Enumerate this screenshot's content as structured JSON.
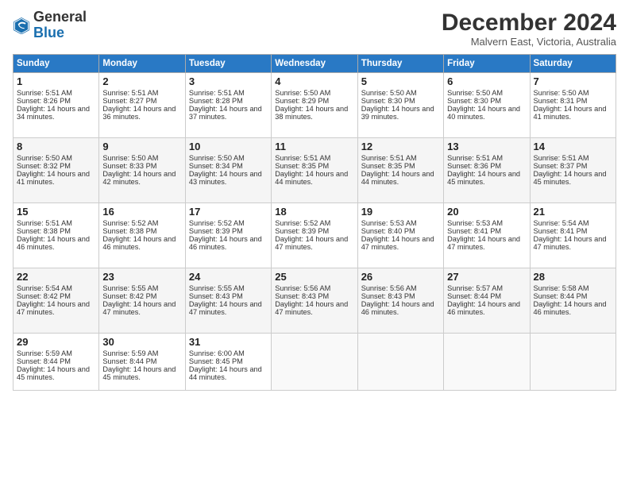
{
  "logo": {
    "general": "General",
    "blue": "Blue"
  },
  "title": "December 2024",
  "location": "Malvern East, Victoria, Australia",
  "days_header": [
    "Sunday",
    "Monday",
    "Tuesday",
    "Wednesday",
    "Thursday",
    "Friday",
    "Saturday"
  ],
  "weeks": [
    [
      {
        "day": "1",
        "sunrise": "Sunrise: 5:51 AM",
        "sunset": "Sunset: 8:26 PM",
        "daylight": "Daylight: 14 hours and 34 minutes."
      },
      {
        "day": "2",
        "sunrise": "Sunrise: 5:51 AM",
        "sunset": "Sunset: 8:27 PM",
        "daylight": "Daylight: 14 hours and 36 minutes."
      },
      {
        "day": "3",
        "sunrise": "Sunrise: 5:51 AM",
        "sunset": "Sunset: 8:28 PM",
        "daylight": "Daylight: 14 hours and 37 minutes."
      },
      {
        "day": "4",
        "sunrise": "Sunrise: 5:50 AM",
        "sunset": "Sunset: 8:29 PM",
        "daylight": "Daylight: 14 hours and 38 minutes."
      },
      {
        "day": "5",
        "sunrise": "Sunrise: 5:50 AM",
        "sunset": "Sunset: 8:30 PM",
        "daylight": "Daylight: 14 hours and 39 minutes."
      },
      {
        "day": "6",
        "sunrise": "Sunrise: 5:50 AM",
        "sunset": "Sunset: 8:30 PM",
        "daylight": "Daylight: 14 hours and 40 minutes."
      },
      {
        "day": "7",
        "sunrise": "Sunrise: 5:50 AM",
        "sunset": "Sunset: 8:31 PM",
        "daylight": "Daylight: 14 hours and 41 minutes."
      }
    ],
    [
      {
        "day": "8",
        "sunrise": "Sunrise: 5:50 AM",
        "sunset": "Sunset: 8:32 PM",
        "daylight": "Daylight: 14 hours and 41 minutes."
      },
      {
        "day": "9",
        "sunrise": "Sunrise: 5:50 AM",
        "sunset": "Sunset: 8:33 PM",
        "daylight": "Daylight: 14 hours and 42 minutes."
      },
      {
        "day": "10",
        "sunrise": "Sunrise: 5:50 AM",
        "sunset": "Sunset: 8:34 PM",
        "daylight": "Daylight: 14 hours and 43 minutes."
      },
      {
        "day": "11",
        "sunrise": "Sunrise: 5:51 AM",
        "sunset": "Sunset: 8:35 PM",
        "daylight": "Daylight: 14 hours and 44 minutes."
      },
      {
        "day": "12",
        "sunrise": "Sunrise: 5:51 AM",
        "sunset": "Sunset: 8:35 PM",
        "daylight": "Daylight: 14 hours and 44 minutes."
      },
      {
        "day": "13",
        "sunrise": "Sunrise: 5:51 AM",
        "sunset": "Sunset: 8:36 PM",
        "daylight": "Daylight: 14 hours and 45 minutes."
      },
      {
        "day": "14",
        "sunrise": "Sunrise: 5:51 AM",
        "sunset": "Sunset: 8:37 PM",
        "daylight": "Daylight: 14 hours and 45 minutes."
      }
    ],
    [
      {
        "day": "15",
        "sunrise": "Sunrise: 5:51 AM",
        "sunset": "Sunset: 8:38 PM",
        "daylight": "Daylight: 14 hours and 46 minutes."
      },
      {
        "day": "16",
        "sunrise": "Sunrise: 5:52 AM",
        "sunset": "Sunset: 8:38 PM",
        "daylight": "Daylight: 14 hours and 46 minutes."
      },
      {
        "day": "17",
        "sunrise": "Sunrise: 5:52 AM",
        "sunset": "Sunset: 8:39 PM",
        "daylight": "Daylight: 14 hours and 46 minutes."
      },
      {
        "day": "18",
        "sunrise": "Sunrise: 5:52 AM",
        "sunset": "Sunset: 8:39 PM",
        "daylight": "Daylight: 14 hours and 47 minutes."
      },
      {
        "day": "19",
        "sunrise": "Sunrise: 5:53 AM",
        "sunset": "Sunset: 8:40 PM",
        "daylight": "Daylight: 14 hours and 47 minutes."
      },
      {
        "day": "20",
        "sunrise": "Sunrise: 5:53 AM",
        "sunset": "Sunset: 8:41 PM",
        "daylight": "Daylight: 14 hours and 47 minutes."
      },
      {
        "day": "21",
        "sunrise": "Sunrise: 5:54 AM",
        "sunset": "Sunset: 8:41 PM",
        "daylight": "Daylight: 14 hours and 47 minutes."
      }
    ],
    [
      {
        "day": "22",
        "sunrise": "Sunrise: 5:54 AM",
        "sunset": "Sunset: 8:42 PM",
        "daylight": "Daylight: 14 hours and 47 minutes."
      },
      {
        "day": "23",
        "sunrise": "Sunrise: 5:55 AM",
        "sunset": "Sunset: 8:42 PM",
        "daylight": "Daylight: 14 hours and 47 minutes."
      },
      {
        "day": "24",
        "sunrise": "Sunrise: 5:55 AM",
        "sunset": "Sunset: 8:43 PM",
        "daylight": "Daylight: 14 hours and 47 minutes."
      },
      {
        "day": "25",
        "sunrise": "Sunrise: 5:56 AM",
        "sunset": "Sunset: 8:43 PM",
        "daylight": "Daylight: 14 hours and 47 minutes."
      },
      {
        "day": "26",
        "sunrise": "Sunrise: 5:56 AM",
        "sunset": "Sunset: 8:43 PM",
        "daylight": "Daylight: 14 hours and 46 minutes."
      },
      {
        "day": "27",
        "sunrise": "Sunrise: 5:57 AM",
        "sunset": "Sunset: 8:44 PM",
        "daylight": "Daylight: 14 hours and 46 minutes."
      },
      {
        "day": "28",
        "sunrise": "Sunrise: 5:58 AM",
        "sunset": "Sunset: 8:44 PM",
        "daylight": "Daylight: 14 hours and 46 minutes."
      }
    ],
    [
      {
        "day": "29",
        "sunrise": "Sunrise: 5:59 AM",
        "sunset": "Sunset: 8:44 PM",
        "daylight": "Daylight: 14 hours and 45 minutes."
      },
      {
        "day": "30",
        "sunrise": "Sunrise: 5:59 AM",
        "sunset": "Sunset: 8:44 PM",
        "daylight": "Daylight: 14 hours and 45 minutes."
      },
      {
        "day": "31",
        "sunrise": "Sunrise: 6:00 AM",
        "sunset": "Sunset: 8:45 PM",
        "daylight": "Daylight: 14 hours and 44 minutes."
      },
      {
        "day": "",
        "sunrise": "",
        "sunset": "",
        "daylight": ""
      },
      {
        "day": "",
        "sunrise": "",
        "sunset": "",
        "daylight": ""
      },
      {
        "day": "",
        "sunrise": "",
        "sunset": "",
        "daylight": ""
      },
      {
        "day": "",
        "sunrise": "",
        "sunset": "",
        "daylight": ""
      }
    ]
  ]
}
